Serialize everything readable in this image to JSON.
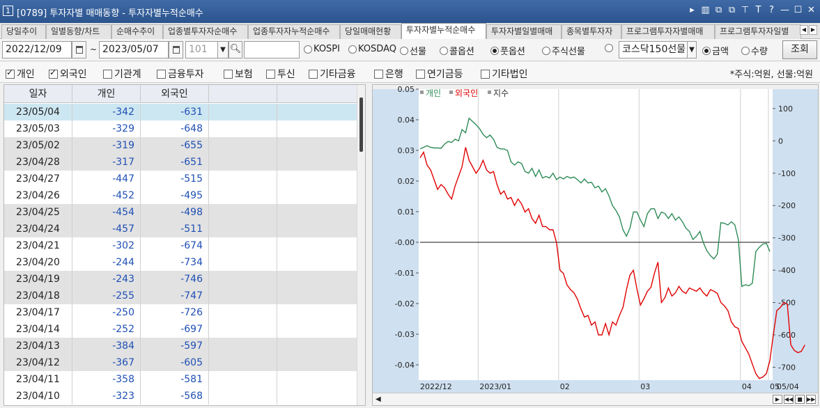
{
  "window": {
    "number": "1",
    "title": "[0789] 투자자별 매매동향 - 투자자별누적순매수",
    "controls": [
      "▸",
      "▥",
      "⧉",
      "⧉",
      "⊤",
      "T",
      "?",
      "—",
      "☐",
      "✕"
    ]
  },
  "tabs": [
    {
      "label": "당일추이"
    },
    {
      "label": "일별동향/차트"
    },
    {
      "label": "순매수추이"
    },
    {
      "label": "업종별투자자순매수"
    },
    {
      "label": "업종투자자누적순매수"
    },
    {
      "label": "당일매매현황"
    },
    {
      "label": "투자자별누적순매수",
      "active": true
    },
    {
      "label": "투자자별일별매매"
    },
    {
      "label": "종목별투자자"
    },
    {
      "label": "프로그램투자자별매매"
    },
    {
      "label": "프로그램투자자일별"
    }
  ],
  "tab_nav": [
    "◀",
    "▶"
  ],
  "controls": {
    "start_date": "2022/12/09",
    "tilde": "~",
    "end_date": "2023/05/07",
    "count_value": "101",
    "search_value": "",
    "markets": [
      {
        "label": "KOSPI",
        "selected": false
      },
      {
        "label": "KOSDAQ",
        "selected": false
      },
      {
        "label": "선물",
        "selected": false
      },
      {
        "label": "콜옵션",
        "selected": false
      },
      {
        "label": "풋옵션",
        "selected": true
      },
      {
        "label": "주식선물",
        "selected": false
      },
      {
        "label": "",
        "selected": false
      }
    ],
    "index_select": "코스닥150선물",
    "units": [
      {
        "label": "금액",
        "selected": true
      },
      {
        "label": "수량",
        "selected": false
      }
    ],
    "query_button": "조회"
  },
  "investors": [
    {
      "label": "개인",
      "checked": true
    },
    {
      "label": "외국인",
      "checked": true
    },
    {
      "label": "기관계",
      "checked": false
    },
    {
      "label": "금융투자",
      "checked": false
    },
    {
      "label": "보험",
      "checked": false
    },
    {
      "label": "투신",
      "checked": false
    },
    {
      "label": "기타금융",
      "checked": false
    },
    {
      "label": "은행",
      "checked": false
    },
    {
      "label": "연기금등",
      "checked": false
    },
    {
      "label": "기타법인",
      "checked": false
    }
  ],
  "unit_note": "*주식:억원, 선물:억원",
  "table": {
    "headers": [
      "일자",
      "개인",
      "외국인",
      "",
      ""
    ],
    "rows": [
      [
        "23/05/04",
        "-342",
        "-631"
      ],
      [
        "23/05/03",
        "-329",
        "-648"
      ],
      [
        "23/05/02",
        "-319",
        "-655"
      ],
      [
        "23/04/28",
        "-317",
        "-651"
      ],
      [
        "23/04/27",
        "-447",
        "-515"
      ],
      [
        "23/04/26",
        "-452",
        "-495"
      ],
      [
        "23/04/25",
        "-454",
        "-498"
      ],
      [
        "23/04/24",
        "-457",
        "-511"
      ],
      [
        "23/04/21",
        "-302",
        "-674"
      ],
      [
        "23/04/20",
        "-244",
        "-734"
      ],
      [
        "23/04/19",
        "-243",
        "-746"
      ],
      [
        "23/04/18",
        "-255",
        "-747"
      ],
      [
        "23/04/17",
        "-250",
        "-726"
      ],
      [
        "23/04/14",
        "-252",
        "-697"
      ],
      [
        "23/04/13",
        "-384",
        "-597"
      ],
      [
        "23/04/12",
        "-367",
        "-605"
      ],
      [
        "23/04/11",
        "-358",
        "-581"
      ],
      [
        "23/04/10",
        "-323",
        "-568"
      ]
    ],
    "selected_row": 0
  },
  "chart_data": {
    "type": "line",
    "legend": [
      {
        "name": "개인",
        "color": "#2e8b57"
      },
      {
        "name": "외국인",
        "color": "#e00000"
      },
      {
        "name": "지수",
        "color": "#333333"
      }
    ],
    "left_axis": {
      "ticks": [
        "0.05",
        "0.04",
        "0.03",
        "0.02",
        "0.01",
        "-0.00",
        "-0.01",
        "-0.02",
        "-0.03",
        "-0.04"
      ],
      "range": [
        -0.045,
        0.05
      ]
    },
    "right_axis": {
      "ticks": [
        "100",
        "0",
        "-100",
        "-200",
        "-300",
        "-400",
        "-500",
        "-600",
        "-700"
      ],
      "range": [
        -740,
        160
      ]
    },
    "x_labels": [
      "2022/12",
      "2023/01",
      "02",
      "03",
      "04",
      "05"
    ],
    "right_corner_label": "05/04",
    "index_line_value": 0.0,
    "series": [
      {
        "name": "개인",
        "color": "#2e8b57",
        "values": [
          -25,
          -20,
          -15,
          -20,
          -22,
          -22,
          -23,
          -10,
          -2,
          -5,
          5,
          0,
          35,
          25,
          70,
          60,
          50,
          38,
          20,
          10,
          18,
          5,
          -20,
          -25,
          -25,
          -30,
          -65,
          -75,
          -65,
          -70,
          -95,
          -100,
          -85,
          -110,
          -90,
          -115,
          -110,
          -115,
          -100,
          -120,
          -112,
          -118,
          -110,
          -115,
          -112,
          -120,
          -130,
          -118,
          -130,
          -128,
          -145,
          -140,
          -158,
          -148,
          -170,
          -200,
          -215,
          -235,
          -275,
          -295,
          -270,
          -220,
          -220,
          -245,
          -265,
          -225,
          -210,
          -210,
          -240,
          -220,
          -225,
          -240,
          -225,
          -245,
          -235,
          -250,
          -270,
          -280,
          -305,
          -295,
          -280,
          -315,
          -340,
          -355,
          -365,
          -350,
          -253,
          -255,
          -260,
          -250,
          -260,
          -305,
          -450,
          -445,
          -448,
          -440,
          -342,
          -329,
          -319,
          -317,
          -342
        ]
      },
      {
        "name": "외국인",
        "color": "#e00000",
        "values": [
          -52,
          -35,
          -75,
          -90,
          -120,
          -150,
          -135,
          -145,
          -165,
          -180,
          -140,
          -110,
          -80,
          -20,
          -60,
          -80,
          -100,
          -85,
          -60,
          -90,
          -100,
          -95,
          -135,
          -165,
          -155,
          -180,
          -175,
          -200,
          -180,
          -195,
          -220,
          -210,
          -240,
          -255,
          -230,
          -265,
          -265,
          -275,
          -275,
          -315,
          -400,
          -410,
          -445,
          -460,
          -470,
          -490,
          -520,
          -545,
          -540,
          -570,
          -560,
          -600,
          -600,
          -565,
          -600,
          -560,
          -570,
          -540,
          -515,
          -460,
          -415,
          -400,
          -458,
          -508,
          -488,
          -465,
          -453,
          -410,
          -375,
          -500,
          -485,
          -455,
          -480,
          -470,
          -450,
          -465,
          -472,
          -455,
          -460,
          -465,
          -455,
          -470,
          -480,
          -460,
          -465,
          -472,
          -500,
          -510,
          -525,
          -560,
          -575,
          -580,
          -620,
          -640,
          -660,
          -690,
          -720,
          -735,
          -730,
          -720,
          -680,
          -600,
          -525,
          -515,
          -500,
          -505,
          -631,
          -648,
          -655,
          -651,
          -631
        ]
      }
    ]
  }
}
